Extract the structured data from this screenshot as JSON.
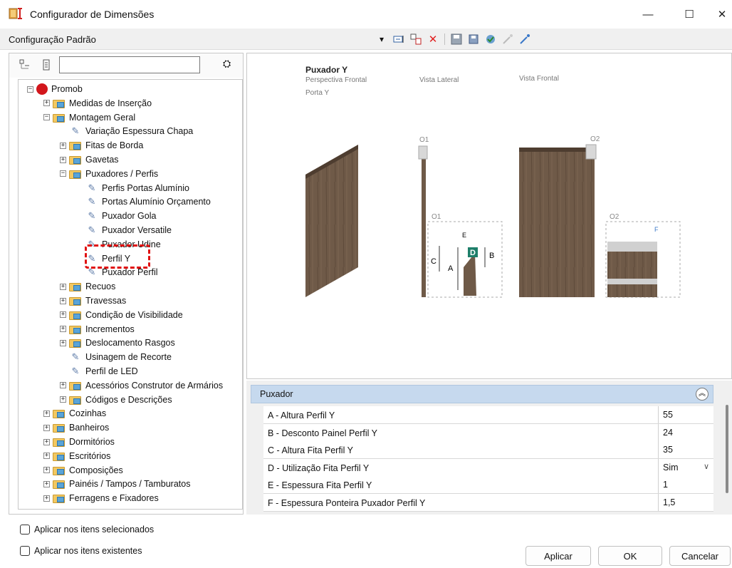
{
  "window": {
    "title": "Configurador de Dimensões",
    "controls": {
      "minimize": "—",
      "maximize": "☐",
      "close": "✕"
    }
  },
  "config": {
    "label": "Configuração Padrão"
  },
  "tree": {
    "search_placeholder": "",
    "nodes": [
      {
        "label": "Promob",
        "type": "root",
        "level": 0
      },
      {
        "label": "Medidas de Inserção",
        "type": "folder",
        "level": 1
      },
      {
        "label": "Montagem Geral",
        "type": "folder-open",
        "level": 1
      },
      {
        "label": "Variação Espessura Chapa",
        "type": "leaf",
        "level": 2
      },
      {
        "label": "Fitas de Borda",
        "type": "folder",
        "level": 2
      },
      {
        "label": "Gavetas",
        "type": "folder",
        "level": 2
      },
      {
        "label": "Puxadores / Perfis",
        "type": "folder-open",
        "level": 2
      },
      {
        "label": "Perfis Portas Alumínio",
        "type": "leaf",
        "level": 3
      },
      {
        "label": "Portas Alumínio Orçamento",
        "type": "leaf",
        "level": 3
      },
      {
        "label": "Puxador Gola",
        "type": "leaf",
        "level": 3
      },
      {
        "label": "Puxador Versatile",
        "type": "leaf",
        "level": 3
      },
      {
        "label": "Puxador Udine",
        "type": "leaf",
        "level": 3
      },
      {
        "label": "Perfil Y",
        "type": "leaf",
        "level": 3
      },
      {
        "label": "Puxador Perfil",
        "type": "leaf",
        "level": 3
      },
      {
        "label": "Recuos",
        "type": "folder",
        "level": 2
      },
      {
        "label": "Travessas",
        "type": "folder",
        "level": 2
      },
      {
        "label": "Condição de Visibilidade",
        "type": "folder",
        "level": 2
      },
      {
        "label": "Incrementos",
        "type": "folder",
        "level": 2
      },
      {
        "label": "Deslocamento Rasgos",
        "type": "folder",
        "level": 2
      },
      {
        "label": "Usinagem de Recorte",
        "type": "leaf",
        "level": 2
      },
      {
        "label": "Perfil de LED",
        "type": "leaf",
        "level": 2
      },
      {
        "label": "Acessórios Construtor de Armários",
        "type": "folder",
        "level": 2
      },
      {
        "label": "Códigos e Descrições",
        "type": "folder",
        "level": 2
      },
      {
        "label": "Cozinhas",
        "type": "folder",
        "level": 1
      },
      {
        "label": "Banheiros",
        "type": "folder",
        "level": 1
      },
      {
        "label": "Dormitórios",
        "type": "folder",
        "level": 1
      },
      {
        "label": "Escritórios",
        "type": "folder",
        "level": 1
      },
      {
        "label": "Composições",
        "type": "folder",
        "level": 1
      },
      {
        "label": "Painéis / Tampos / Tamburatos",
        "type": "folder",
        "level": 1
      },
      {
        "label": "Ferragens e Fixadores",
        "type": "folder",
        "level": 1
      }
    ]
  },
  "checkboxes": {
    "selected": "Aplicar nos itens selecionados",
    "existing": "Aplicar nos itens existentes"
  },
  "preview": {
    "title": "Puxador Y",
    "subtitle": "Perspectiva Frontal",
    "door_label": "Porta Y",
    "lateral": "Vista Lateral",
    "frontal": "Vista Frontal",
    "markers": {
      "o1": "O1",
      "o2": "O2",
      "a": "A",
      "b": "B",
      "c": "C",
      "d": "D",
      "e": "E",
      "f": "F"
    },
    "colors": {
      "wood": "#6f5a48",
      "wood_dark": "#4e3d30",
      "accent": "#1e7f6a"
    }
  },
  "properties": {
    "group": "Puxador",
    "rows": [
      {
        "label": "A - Altura Perfil Y",
        "value": "55"
      },
      {
        "label": "B - Desconto Painel Perfil Y",
        "value": "24"
      },
      {
        "label": "C - Altura Fita Perfil Y",
        "value": "35"
      },
      {
        "label": "D - Utilização Fita Perfil Y",
        "value": "Sim"
      },
      {
        "label": "E - Espessura Fita Perfil Y",
        "value": "1"
      },
      {
        "label": "F - Espessura Ponteira Puxador Perfil Y",
        "value": "1,5"
      }
    ]
  },
  "buttons": {
    "apply": "Aplicar",
    "ok": "OK",
    "cancel": "Cancelar"
  }
}
